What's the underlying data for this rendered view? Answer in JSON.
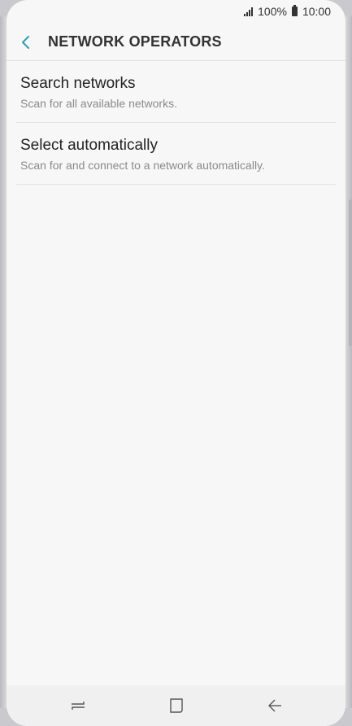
{
  "status_bar": {
    "battery_percent": "100%",
    "time": "10:00",
    "signal_icon": "signal-icon",
    "battery_icon": "battery-icon"
  },
  "header": {
    "back_icon": "chevron-left-icon",
    "title": "NETWORK OPERATORS",
    "accent_color": "#2f9db0"
  },
  "list": {
    "items": [
      {
        "title": "Search networks",
        "subtitle": "Scan for all available networks."
      },
      {
        "title": "Select automatically",
        "subtitle": "Scan for and connect to a network automatically."
      }
    ]
  },
  "nav_bar": {
    "recent_icon": "recent-apps-icon",
    "home_icon": "home-icon",
    "back_icon": "back-arrow-icon"
  }
}
